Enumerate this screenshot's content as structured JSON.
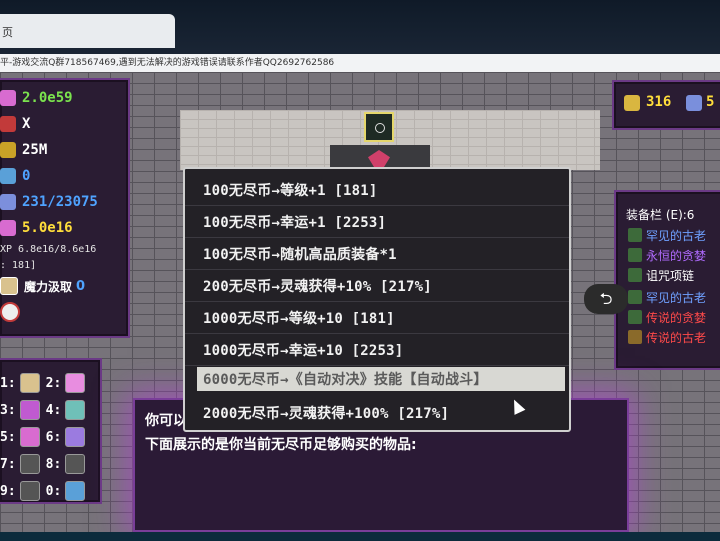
{
  "browser": {
    "tab_title": "页",
    "notice": "平-游戏交流Q群718567469,遇到无法解决的游戏错误请联系作者QQ2692762586"
  },
  "stats": [
    {
      "icon": "heart-icon",
      "color": "#d86bd0",
      "value": "2.0e59",
      "value_color": "#7be34e"
    },
    {
      "icon": "sword-icon",
      "color": "#c23a3a",
      "value": "X",
      "value_color": "#ffffff"
    },
    {
      "icon": "shield-icon",
      "color": "#c9a227",
      "value": "25M",
      "value_color": "#ffffff"
    },
    {
      "icon": "boots-icon",
      "color": "#5aa0d8",
      "value": "0",
      "value_color": "#4fa3ff"
    },
    {
      "icon": "crystal-icon",
      "color": "#7c8fdc",
      "value": "231/23075",
      "value_color": "#4fa3ff"
    },
    {
      "icon": "clover-icon",
      "color": "#d86bd0",
      "value": "5.0e16",
      "value_color": "#ffde3b"
    }
  ],
  "xp_text": "XP 6.8e16/8.6e16",
  "level_text": ": 181]",
  "mana_drain": {
    "label": "魔力汲取",
    "value": "0"
  },
  "skills": [
    {
      "key": "1:",
      "key2": "2:"
    },
    {
      "key": "3:",
      "key2": "4:"
    },
    {
      "key": "5:",
      "key2": "6:"
    },
    {
      "key": "7:",
      "key2": "8:"
    },
    {
      "key": "9:",
      "key2": "0:"
    }
  ],
  "resources": {
    "coins": "316",
    "keys": "5"
  },
  "equipment": {
    "title": "装备栏 (E):6",
    "items": [
      {
        "name": "罕见的古老",
        "color": "#6fa0ff"
      },
      {
        "name": "永恒的贪婪",
        "color": "#b06bff"
      },
      {
        "name": "诅咒项链",
        "color": "#ffffff"
      },
      {
        "name": "罕见的古老",
        "color": "#6fa0ff"
      },
      {
        "name": "传说的贪婪",
        "color": "#ff4a4a"
      },
      {
        "name": "传说的古老",
        "color": "#ff4a4a"
      }
    ]
  },
  "back_symbol": "⮌",
  "menu": {
    "items": [
      "100无尽币→等级+1 [181]",
      "100无尽币→幸运+1 [2253]",
      "100无尽币→随机高品质装备*1",
      "200无尽币→灵魂获得+10% [217%]",
      "1000无尽币→等级+10 [181]",
      "1000无尽币→幸运+10 [2253]",
      "6000无尽币→《自动对决》技能【自动战斗】",
      "2000无尽币→灵魂获得+100% [217%]"
    ],
    "selected_index": 6
  },
  "dialog": {
    "line1": "你可以",
    "line2": "下面展示的是你当前无尽币足够购买的物品:"
  }
}
